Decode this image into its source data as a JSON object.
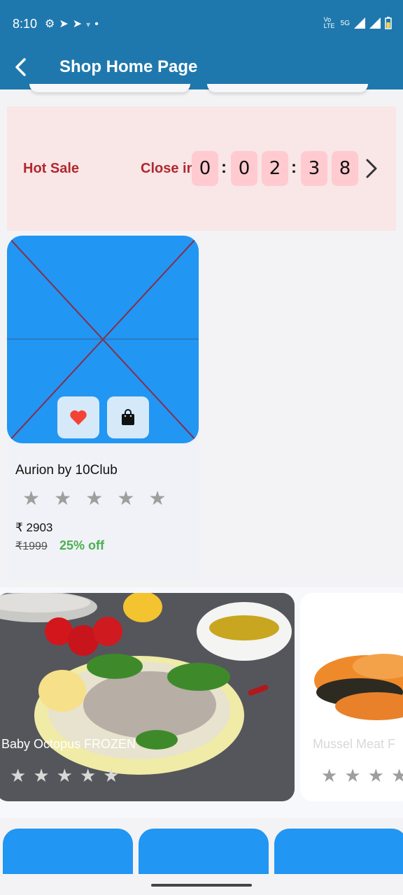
{
  "status_bar": {
    "time": "8:10",
    "left_icons": [
      "gear-icon",
      "telegram-icon",
      "telegram-icon",
      "wifi-icon",
      "dot-icon"
    ],
    "network": "5G",
    "sim_label": "Vo LTE"
  },
  "app_bar": {
    "title": "Shop Home Page",
    "back_icon": "chevron-left-icon"
  },
  "hot_sale": {
    "label": "Hot Sale",
    "close_in_label": "Close in",
    "countdown_digits": [
      "0",
      "0",
      "2",
      "3",
      "8"
    ],
    "separator": ":"
  },
  "product": {
    "name": "Aurion by 10Club",
    "rating_stars": 5,
    "star_glyph": "★",
    "price": "₹ 2903",
    "old_price": "₹1999",
    "discount": "25% off",
    "actions": [
      "heart-icon",
      "shopping-bag-icon"
    ]
  },
  "banners": [
    {
      "label": "Baby Octopus FROZEN"
    },
    {
      "label": "Mussel Meat F"
    }
  ],
  "colors": {
    "primary": "#1f78ad",
    "accent_blue": "#2196f3",
    "sale_text": "#b0282f",
    "digit_bg": "#ffcbd0",
    "discount_green": "#4caf50",
    "heart_red": "#f44336"
  }
}
